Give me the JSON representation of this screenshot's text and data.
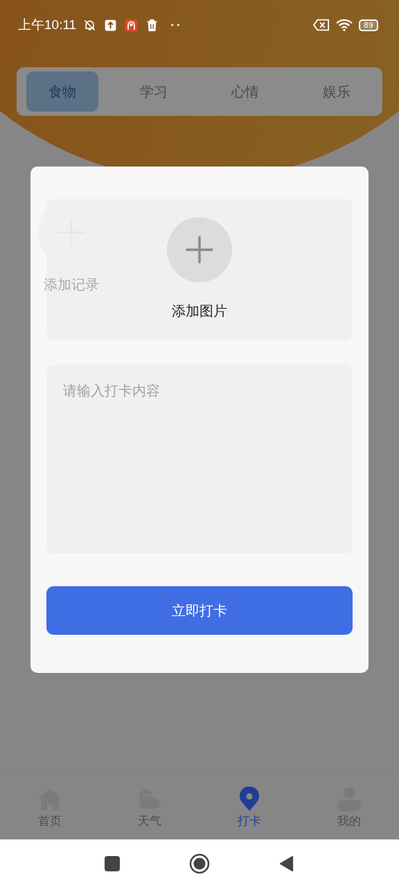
{
  "status_bar": {
    "time": "上午10:11",
    "battery": "89"
  },
  "tabs": [
    {
      "label": "食物",
      "selected": true
    },
    {
      "label": "学习",
      "selected": false
    },
    {
      "label": "心情",
      "selected": false
    },
    {
      "label": "娱乐",
      "selected": false
    }
  ],
  "background": {
    "add_record": {
      "label": "添加记录"
    }
  },
  "dialog": {
    "image_picker": {
      "label": "添加图片"
    },
    "content_field": {
      "placeholder": "请输入打卡内容"
    },
    "submit_button": "立即打卡"
  },
  "bottom_nav": [
    {
      "kind": "home",
      "label": "首页",
      "selected": false
    },
    {
      "kind": "weather",
      "label": "天气",
      "selected": false
    },
    {
      "kind": "checkin",
      "label": "打卡",
      "selected": true
    },
    {
      "kind": "profile",
      "label": "我的",
      "selected": false
    }
  ]
}
